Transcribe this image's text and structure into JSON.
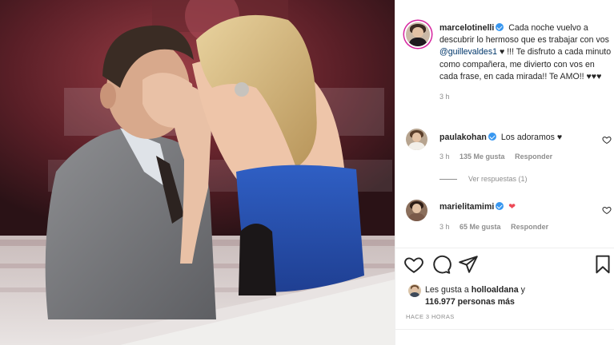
{
  "post": {
    "author": "marcelotinelli",
    "caption_part1": "Cada noche vuelvo a descubrir lo hermoso que es trabajar con vos",
    "mention": "@guillevaldes1",
    "caption_part2": "♥ !!! Te disfruto a cada minuto como compañera, me divierto con vos en cada frase, en cada mirada!! Te AMO!! ♥♥♥",
    "time": "3 h"
  },
  "comments": [
    {
      "user": "paulakohan",
      "text": "Los adoramos ♥",
      "time": "3 h",
      "likes": "135 Me gusta",
      "reply": "Responder",
      "view_replies": "Ver respuestas (1)"
    },
    {
      "user": "marielitamimi",
      "text": "❤",
      "time": "3 h",
      "likes": "65 Me gusta",
      "reply": "Responder"
    }
  ],
  "likes": {
    "prefix": "Les gusta a",
    "first_user": "holloaldana",
    "connector": "y",
    "count": "116.977 personas más"
  },
  "posted_ago": "HACE 3 HORAS",
  "icons": {
    "like": "heart-outline-icon",
    "comment": "comment-bubble-icon",
    "share": "paper-plane-icon",
    "save": "bookmark-icon"
  },
  "colors": {
    "verified": "#3897f0",
    "mention": "#00376b",
    "heart_red": "#ed4956",
    "muted": "#8e8e8e"
  }
}
